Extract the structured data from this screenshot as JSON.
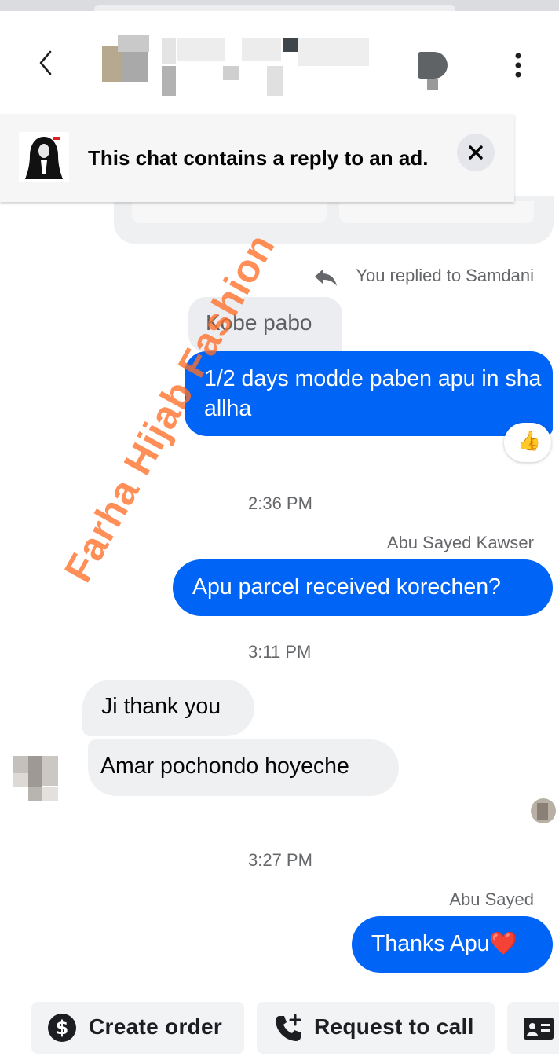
{
  "banner": {
    "text": "This chat contains a reply to an ad."
  },
  "reply_note": "You replied to Samdani",
  "quoted_message": "Kobe pabo",
  "messages": {
    "m1": "1/2 days modde paben apu in sha allha",
    "m1_reaction": "👍",
    "ts1": "2:36 PM",
    "sender1": "Abu Sayed Kawser",
    "m2": "Apu parcel received korechen?",
    "ts2": "3:11 PM",
    "in1": "Ji thank you",
    "in2": "Amar pochondo hoyeche",
    "ts3": "3:27 PM",
    "sender2": "Abu Sayed",
    "m3": "Thanks Apu",
    "m3_emoji": "❤️"
  },
  "actions": {
    "create_order": "Create order",
    "request_call": "Request to call"
  },
  "watermark": "Farha Hijab Fashion",
  "colors": {
    "accent": "#0064f6",
    "incoming": "#eff0f2",
    "watermark": "#ff6e28"
  }
}
